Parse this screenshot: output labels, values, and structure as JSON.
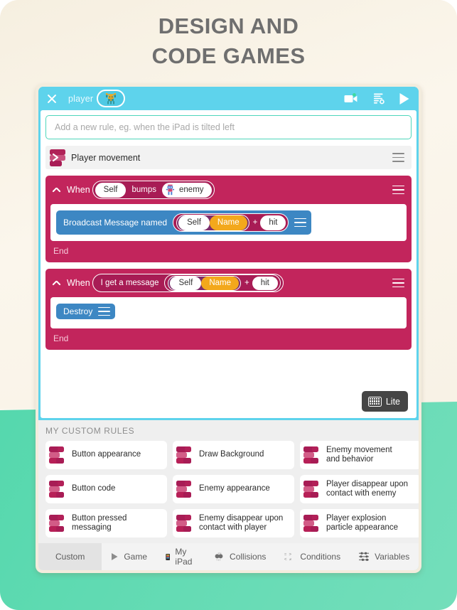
{
  "headline": {
    "line1": "DESIGN AND",
    "line2": "CODE GAMES"
  },
  "toolbar": {
    "close_icon": "close-icon",
    "object_name": "player",
    "object_sprite": "player-robot-sprite",
    "video_icon": "video-record-icon",
    "notes_icon": "script-list-icon",
    "play_icon": "play-icon"
  },
  "new_rule": {
    "placeholder": "Add a new rule, eg. when the iPad is tilted left"
  },
  "rule_header": {
    "title": "Player movement",
    "menu_icon": "hamburger-menu-icon"
  },
  "rules": [
    {
      "when_label": "When",
      "condition": {
        "subject": "Self",
        "verb": "bumps",
        "object": "enemy",
        "object_sprite": "enemy-robot-sprite"
      },
      "action": {
        "label": "Broadcast Message named",
        "token_self": "Self",
        "token_name": "Name",
        "operator": "+",
        "token_text": "hit"
      },
      "end_label": "End"
    },
    {
      "when_label": "When",
      "condition_text": "I get a message",
      "message": {
        "token_self": "Self",
        "token_name": "Name",
        "operator": "+",
        "token_text": "hit"
      },
      "action": {
        "label": "Destroy"
      },
      "end_label": "End"
    }
  ],
  "lite_badge": {
    "label": "Lite",
    "icon": "keyboard-icon"
  },
  "library": {
    "title": "MY CUSTOM RULES",
    "cards": [
      "Button appearance",
      "Draw Background",
      "Enemy movement\nand behavior",
      "Button code",
      "Enemy appearance",
      "Player disappear upon\ncontact with enemy",
      "Button pressed\nmessaging",
      "Enemy disappear upon\ncontact with player",
      "Player explosion\nparticle appearance"
    ]
  },
  "tabs": [
    {
      "label": "Custom",
      "icon": "",
      "active": true
    },
    {
      "label": "Game",
      "icon": "play-icon",
      "active": false
    },
    {
      "label": "My iPad",
      "icon": "ipad-icon",
      "active": false
    },
    {
      "label": "Collisions",
      "icon": "collisions-icon",
      "active": false
    },
    {
      "label": "Conditions",
      "icon": "conditions-icon",
      "active": false
    },
    {
      "label": "Variables",
      "icon": "variables-icon",
      "active": false
    }
  ],
  "tab_delete_icon": "backspace-delete-icon",
  "colors": {
    "screen_blue": "#5ed3ec",
    "rule_magenta": "#c2255c",
    "capsule_dark": "#a81c55",
    "inner_purple": "#7d2d6b",
    "amber": "#f3a81c",
    "action_blue": "#3d87c3",
    "teal_accent": "#4ed6bb",
    "backdrop_cream": "#f7f1e4",
    "backdrop_teal": "#6ddcb4",
    "headline_grey": "#6f6f6f"
  }
}
